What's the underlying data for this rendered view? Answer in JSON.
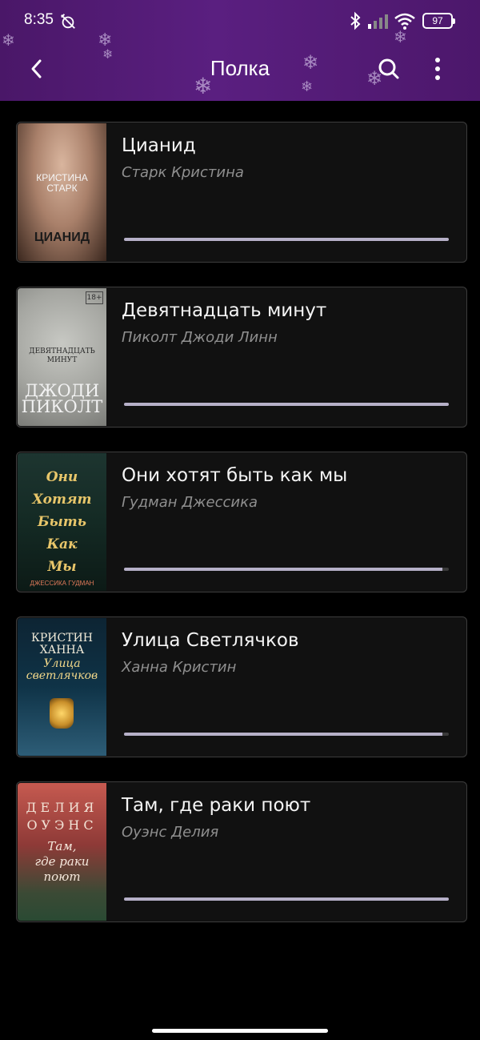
{
  "status_bar": {
    "time": "8:35",
    "battery": "97",
    "icons": [
      "alarm-off-icon",
      "bluetooth-icon",
      "signal-icon",
      "wifi-icon",
      "battery-icon"
    ]
  },
  "app_bar": {
    "title": "Полка",
    "background": "#4f1b72",
    "icons": [
      "back-arrow-icon",
      "search-icon",
      "more-vert-icon"
    ]
  },
  "books": [
    {
      "title": "Цианид",
      "author": "Старк Кристина",
      "progress": 1.0,
      "cover": {
        "text_top": "КРИСТИНА\nСТАРК",
        "text_bottom": "ЦИАНИД",
        "colors": [
          "#c9a58e",
          "#7a5a48",
          "#2a1b14"
        ]
      }
    },
    {
      "title": "Девятнадцать минут",
      "author": "Пиколт Джоди Линн",
      "progress": 1.0,
      "cover": {
        "text_top": "ДЕВЯТНАДЦАТЬ\nМИНУТ",
        "text_bottom": "ДЖОДИ\nПИКОЛТ",
        "colors": [
          "#b9bab5",
          "#9c9d98",
          "#6b6c68"
        ]
      }
    },
    {
      "title": "Они хотят быть как мы",
      "author": "Гудман Джессика",
      "progress": 0.98,
      "cover": {
        "text_top": "Они\nХотят\nБыть\nКак\nМы",
        "text_bottom": "ДЖЕССИКА ГУДМАН",
        "colors": [
          "#1f3a34",
          "#12261f",
          "#0b1613"
        ]
      }
    },
    {
      "title": "Улица Светлячков",
      "author": "Ханна Кристин",
      "progress": 0.98,
      "cover": {
        "text_top": "КРИСТИН\nХАННА",
        "text_bottom": "Улица\nсветлячков",
        "colors": [
          "#0f2d3c",
          "#123b52",
          "#2b5f7a"
        ]
      }
    },
    {
      "title": "Там, где раки поют",
      "author": "Оуэнс Делия",
      "progress": 1.0,
      "cover": {
        "text_top": "ДЕЛИЯ\nОУЭНС",
        "text_bottom": "Там,\nгде раки\nпоют",
        "colors": [
          "#c0504a",
          "#6e2a2a",
          "#2c5a3c"
        ]
      }
    }
  ]
}
